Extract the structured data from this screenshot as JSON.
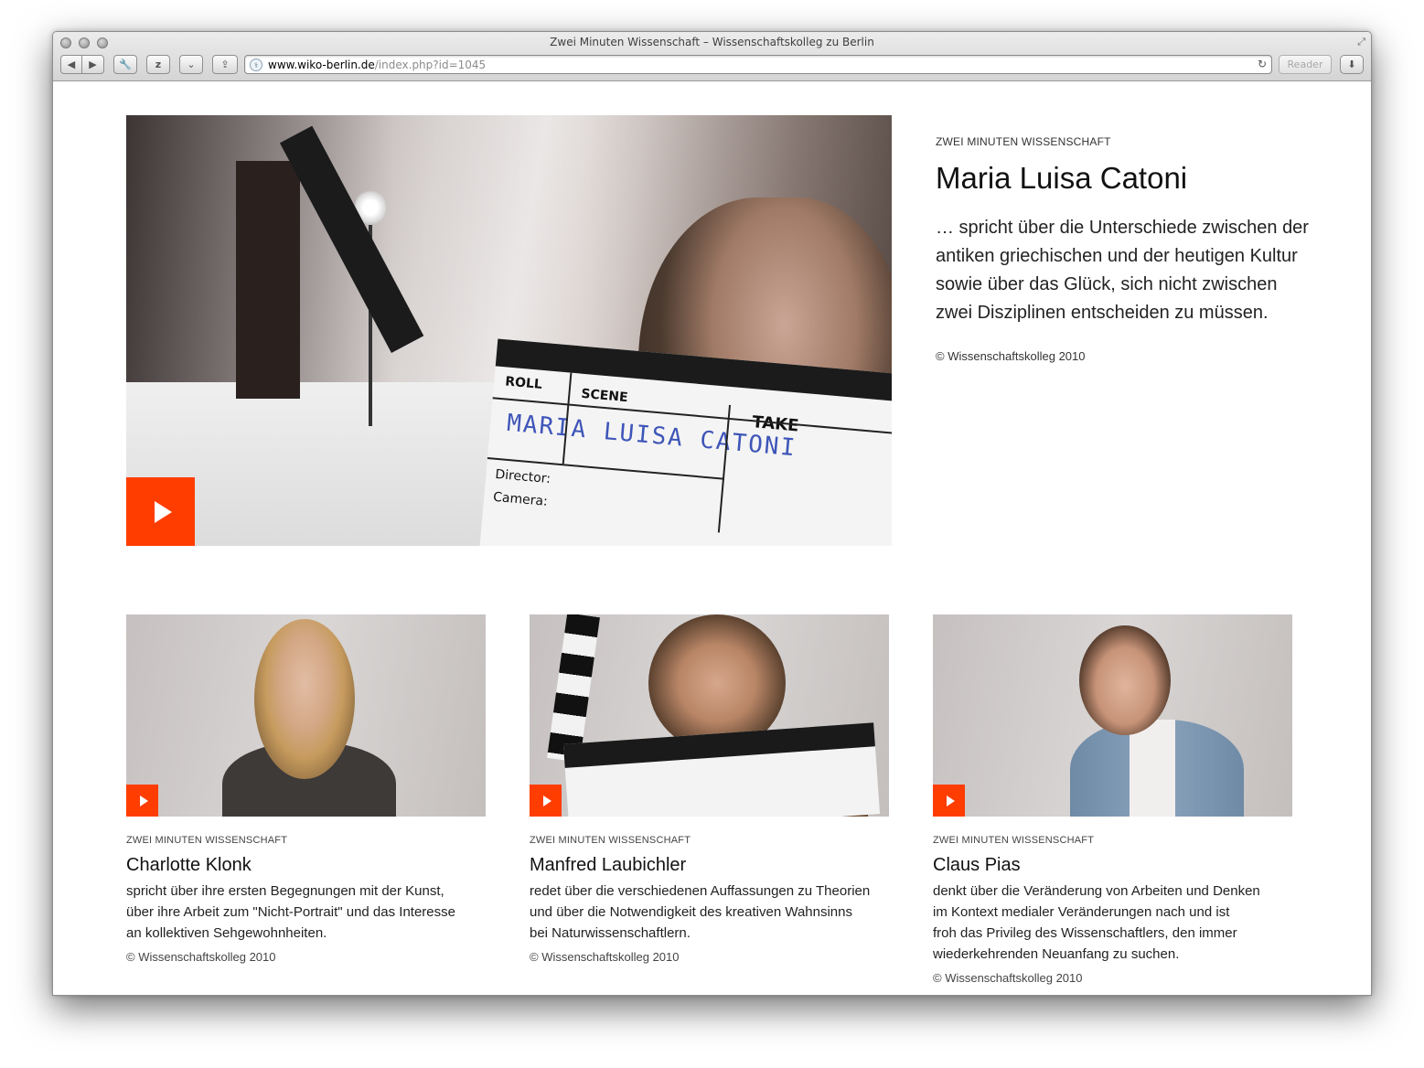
{
  "window": {
    "title": "Zwei Minuten Wissenschaft – Wissenschaftskolleg zu Berlin"
  },
  "toolbar": {
    "url_domain": "www.wiko-berlin.de",
    "url_path": "/index.php?id=1045",
    "reader_label": "Reader",
    "back_glyph": "◀",
    "forward_glyph": "▶",
    "wrench_glyph": "🔧",
    "z_glyph": "z",
    "pocket_glyph": "⌄",
    "share_glyph": "⇪",
    "download_glyph": "⬇",
    "reload_glyph": "↻",
    "favicon_glyph": "⚕",
    "fullscreen_glyph": "⤢"
  },
  "featured": {
    "kicker": "ZWEI MINUTEN WISSENSCHAFT",
    "name": "Maria Luisa Catoni",
    "description": "… spricht über die Unterschiede zwischen der antiken griechischen und der heutigen Kultur sowie über das Glück, sich nicht zwischen zwei Disziplinen entscheiden zu müssen.",
    "copyright": "© Wissenschaftskolleg 2010",
    "slate": {
      "roll": "ROLL",
      "scene": "SCENE",
      "take": "TAKE",
      "director": "Director:",
      "camera": "Camera:",
      "written_name": "MARIA LUISA CATONI"
    }
  },
  "videos": [
    {
      "kicker": "ZWEI MINUTEN WISSENSCHAFT",
      "name": "Charlotte Klonk",
      "description": "spricht über ihre ersten Begegnungen mit der Kunst,\nüber ihre Arbeit zum \"Nicht-Portrait\" und das Interesse\nan kollektiven Sehgewohnheiten.",
      "copyright": "© Wissenschaftskolleg 2010"
    },
    {
      "kicker": "ZWEI MINUTEN WISSENSCHAFT",
      "name": "Manfred Laubichler",
      "description": "redet über die verschiedenen Auffassungen zu Theorien\nund über die Notwendigkeit des kreativen Wahnsinns\nbei Naturwissenschaftlern.",
      "copyright": "© Wissenschaftskolleg 2010"
    },
    {
      "kicker": "ZWEI MINUTEN WISSENSCHAFT",
      "name": "Claus Pias",
      "description": "denkt über die Veränderung von Arbeiten und Denken\nim Kontext medialer Veränderungen nach und ist\nfroh das Privileg des Wissenschaftlers, den immer\nwiederkehrenden Neuanfang zu suchen.",
      "copyright": "© Wissenschaftskolleg 2010"
    }
  ],
  "colors": {
    "accent": "#ff3d00",
    "text": "#111111"
  }
}
